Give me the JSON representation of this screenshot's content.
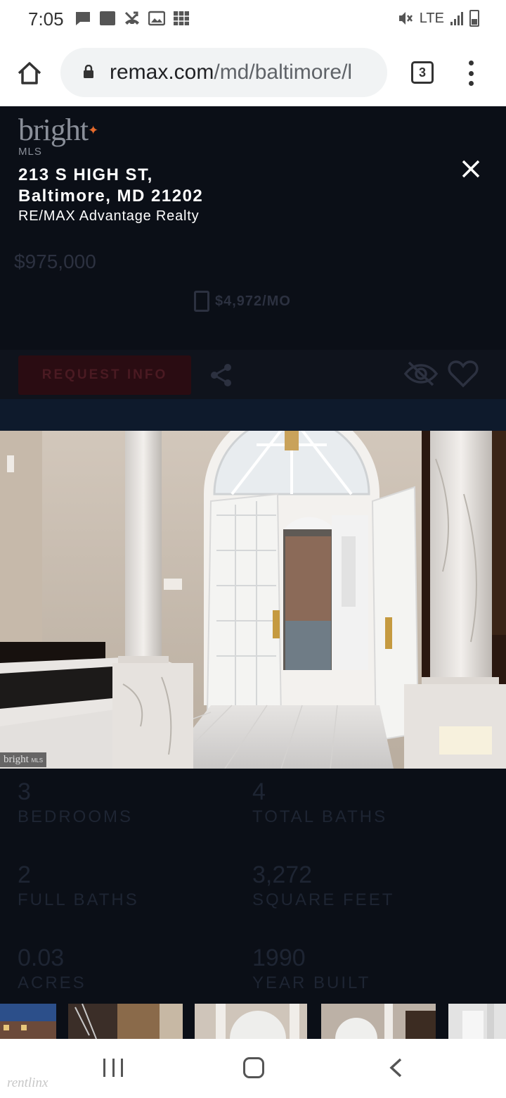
{
  "status_bar": {
    "time": "7:05",
    "network": "LTE",
    "left_icons": [
      "message-icon",
      "square-icon",
      "missed-call-icon",
      "image-icon",
      "grid-icon"
    ],
    "right_icons": [
      "mute-icon",
      "signal-icon",
      "battery-icon"
    ]
  },
  "browser": {
    "url_host": "remax.com",
    "url_path": "/md/baltimore/l",
    "tab_count": "3"
  },
  "listing": {
    "logo_text": "bright",
    "logo_sub": "MLS",
    "address_line1": "213 S HIGH ST,",
    "address_line2": "Baltimore, MD 21202",
    "agency": "RE/MAX Advantage Realty",
    "price": "$975,000",
    "monthly": "$4,972/MO",
    "request_label": "REQUEST INFO"
  },
  "photo": {
    "watermark": "bright",
    "watermark_sub": "MLS"
  },
  "stats": [
    {
      "value": "3",
      "label": "BEDROOMS"
    },
    {
      "value": "4",
      "label": "TOTAL BATHS"
    },
    {
      "value": "2",
      "label": "FULL BATHS"
    },
    {
      "value": "3,272",
      "label": "SQUARE FEET"
    },
    {
      "value": "0.03",
      "label": "ACRES"
    },
    {
      "value": "1990",
      "label": "YEAR BUILT"
    }
  ],
  "footer": {
    "watermark": "rentlinx"
  },
  "colors": {
    "overlay_bg": "#0b0f17",
    "accent_orange": "#e56a2c",
    "request_button": "#2a0c12"
  }
}
